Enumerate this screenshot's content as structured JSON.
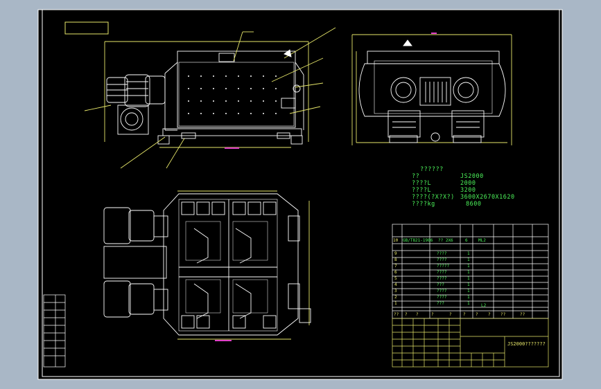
{
  "specs": {
    "title": "??????",
    "rows": [
      {
        "label": "??",
        "value": "JS2000"
      },
      {
        "label": "????L",
        "value": "2000"
      },
      {
        "label": "????L",
        "value": "3200"
      },
      {
        "label": "????(?X?X?)",
        "value": "3600X2670X1620"
      },
      {
        "label": "????kg",
        "value": "8600"
      }
    ]
  },
  "parts_table": {
    "row10": {
      "no": "10",
      "code": "GB/T821-1986",
      "name": "?? 2X6",
      "qty": "6",
      "note": "ML2"
    },
    "rows": [
      {
        "no": "9",
        "name": "????",
        "qty": "1"
      },
      {
        "no": "8",
        "name": "????",
        "qty": "1"
      },
      {
        "no": "7",
        "name": "?????",
        "qty": "1"
      },
      {
        "no": "6",
        "name": "????",
        "qty": "1"
      },
      {
        "no": "5",
        "name": "????",
        "qty": "1"
      },
      {
        "no": "4",
        "name": "???",
        "qty": "1"
      },
      {
        "no": "3",
        "name": "????",
        "qty": "1"
      },
      {
        "no": "2",
        "name": "????",
        "qty": "1"
      },
      {
        "no": "1",
        "name": "???",
        "qty": "1"
      }
    ],
    "extra_l2": "L2",
    "header": [
      "??",
      "?",
      "?",
      "?",
      "?",
      "?",
      "?",
      "?",
      "??",
      "??"
    ]
  },
  "title_block": {
    "drawing_title": "JS2000???????"
  },
  "colors": {
    "background": "#a9b7c6",
    "paper": "#000000",
    "frame": "#ffffff",
    "outline": "#ffffff",
    "dimension": "#e8e86a",
    "leader": "#e8e86a",
    "text_green": "#4cf25a",
    "accent_cyan": "#3fd2e0",
    "accent_magenta": "#e040c8"
  }
}
